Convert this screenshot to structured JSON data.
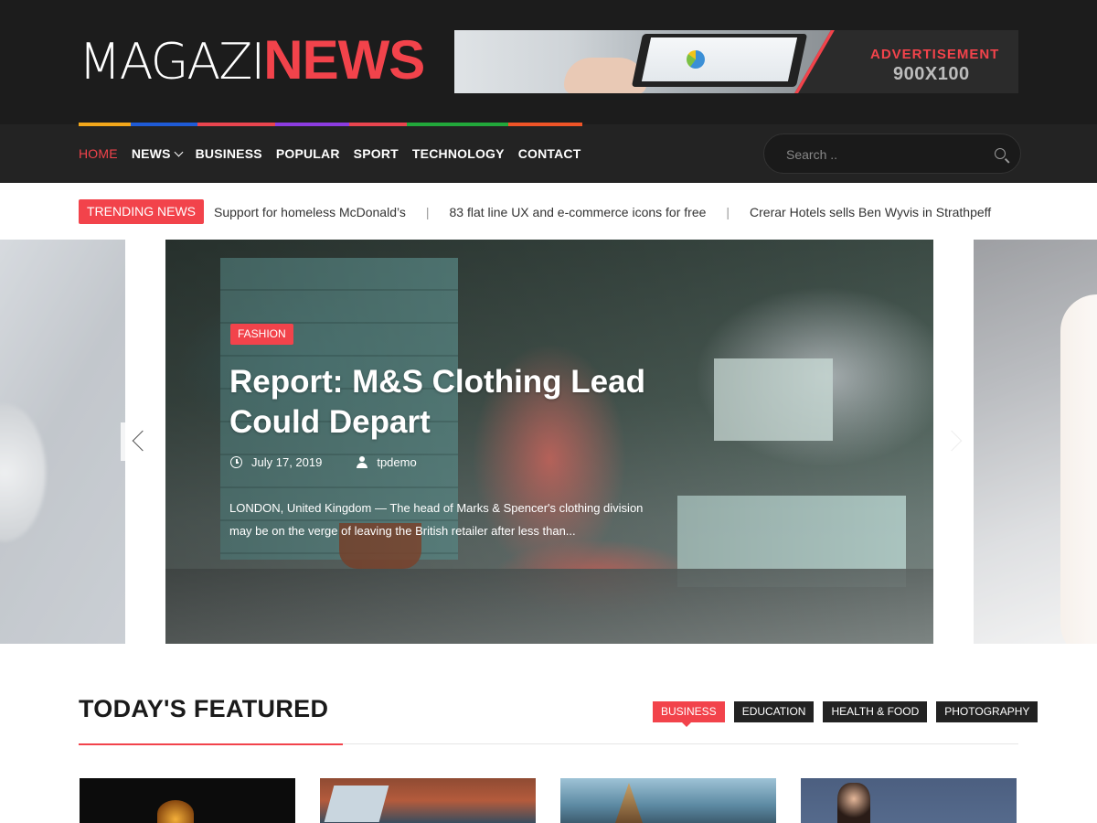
{
  "logo": {
    "part1": "MAGAZI",
    "part2": "NEWS"
  },
  "ad": {
    "line1": "ADVERTISEMENT",
    "line2": "900X100"
  },
  "colors": {
    "accent": "#f2434b",
    "header_bg": "#1c1c1c",
    "nav_bg": "#232323"
  },
  "color_stripes": [
    "#f2a71b",
    "#1f5bd6",
    "#e9454f",
    "#8c3ce0",
    "#e9454f",
    "#22a83b",
    "#ef5427"
  ],
  "nav": {
    "items": [
      {
        "label": "HOME",
        "active": true
      },
      {
        "label": "NEWS",
        "dropdown": true
      },
      {
        "label": "BUSINESS"
      },
      {
        "label": "POPULAR"
      },
      {
        "label": "SPORT"
      },
      {
        "label": "TECHNOLOGY"
      },
      {
        "label": "CONTACT"
      }
    ]
  },
  "search": {
    "placeholder": "Search ..",
    "icon": "search-icon"
  },
  "trending": {
    "label": "TRENDING NEWS",
    "items": [
      "Support for homeless McDonald’s",
      "83 flat line UX and e-commerce icons for free",
      "Crerar Hotels sells Ben Wyvis in Strathpeff"
    ]
  },
  "slide": {
    "category": "FASHION",
    "title": "Report: M&S Clothing Lead Could Depart",
    "date": "July 17, 2019",
    "author": "tpdemo",
    "excerpt": "LONDON, United Kingdom — The head of Marks & Spencer's clothing division may be on the verge of leaving the British retailer after less than..."
  },
  "featured": {
    "title": "TODAY'S FEATURED",
    "tabs": [
      {
        "label": "BUSINESS",
        "active": true
      },
      {
        "label": "EDUCATION"
      },
      {
        "label": "HEALTH & FOOD"
      },
      {
        "label": "PHOTOGRAPHY"
      }
    ]
  }
}
